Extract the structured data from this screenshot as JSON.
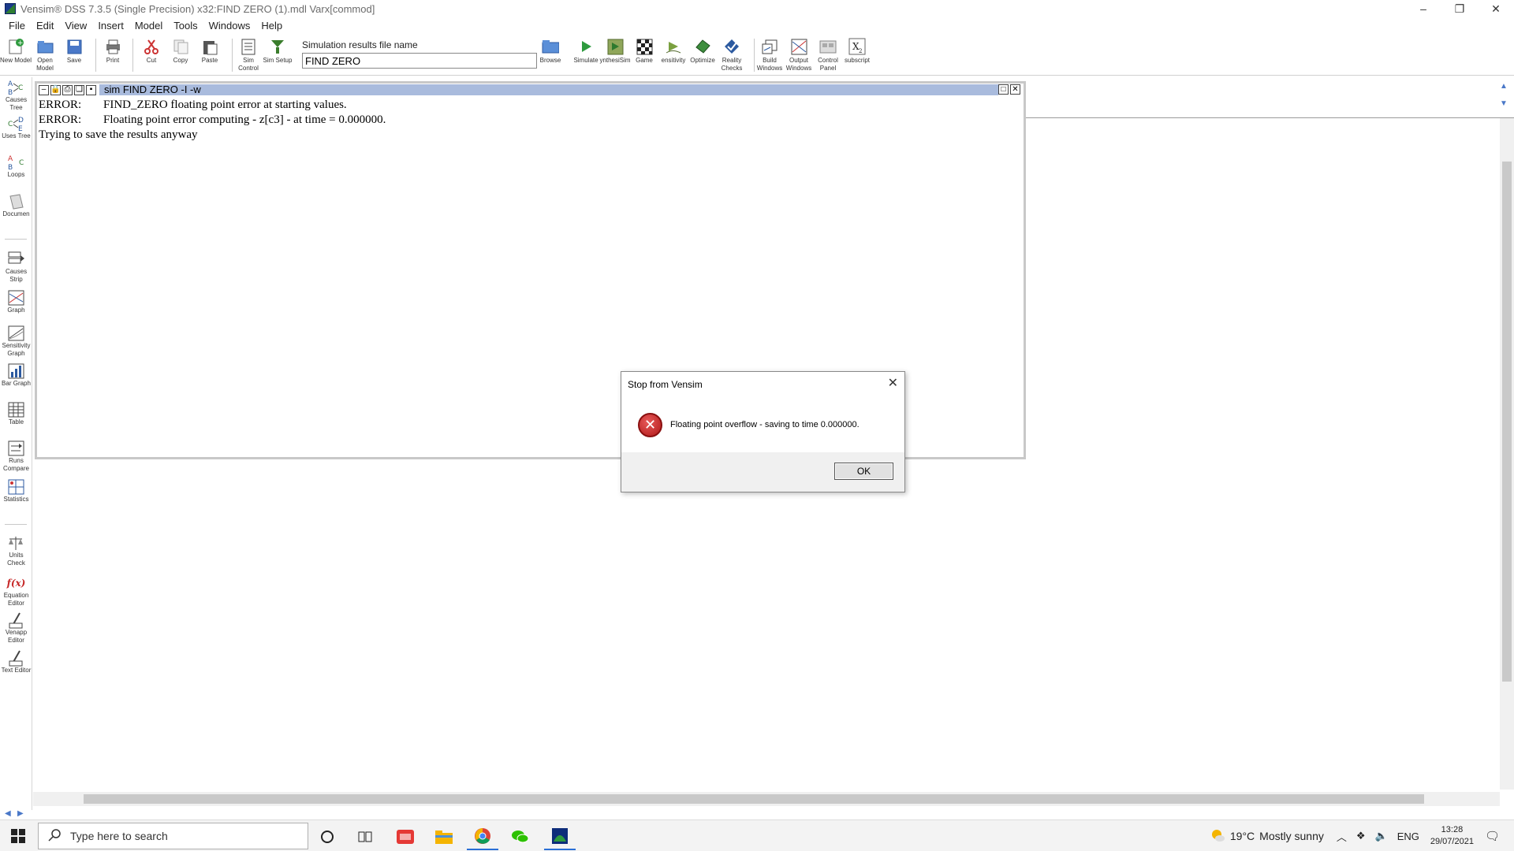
{
  "window": {
    "title": "Vensim® DSS 7.3.5 (Single Precision) x32:FIND ZERO (1).mdl Varx[commod]",
    "controls": [
      "–",
      "❐",
      "✕"
    ]
  },
  "menu": [
    "File",
    "Edit",
    "View",
    "Insert",
    "Model",
    "Tools",
    "Windows",
    "Help"
  ],
  "toolbar": {
    "buttons": [
      {
        "label": "New Model",
        "icon": "new-model-icon"
      },
      {
        "label": "Open Model",
        "icon": "open-model-icon"
      },
      {
        "label": "Save",
        "icon": "save-icon"
      },
      {
        "label": "Print",
        "icon": "print-icon"
      },
      {
        "label": "Cut",
        "icon": "cut-icon"
      },
      {
        "label": "Copy",
        "icon": "copy-icon"
      },
      {
        "label": "Paste",
        "icon": "paste-icon"
      },
      {
        "label": "Sim Control",
        "icon": "sim-control-icon"
      },
      {
        "label": "Sim Setup",
        "icon": "sim-setup-icon"
      },
      {
        "label": "Browse",
        "icon": "browse-icon"
      },
      {
        "label": "Simulate",
        "icon": "simulate-icon"
      },
      {
        "label": "ynthesiSim",
        "icon": "synthesim-icon"
      },
      {
        "label": "Game",
        "icon": "game-icon"
      },
      {
        "label": "ensitivity",
        "icon": "sensitivity-icon"
      },
      {
        "label": "Optimize",
        "icon": "optimize-icon"
      },
      {
        "label": "Reality Checks",
        "icon": "reality-checks-icon"
      },
      {
        "label": "Build Windows",
        "icon": "build-windows-icon"
      },
      {
        "label": "Output Windows",
        "icon": "output-windows-icon"
      },
      {
        "label": "Control Panel",
        "icon": "control-panel-icon"
      },
      {
        "label": "subscript",
        "icon": "subscript-icon"
      }
    ],
    "sim_label": "Simulation results file name",
    "sim_value": "FIND ZERO"
  },
  "sidebar": {
    "tools": [
      {
        "label": "Causes Tree",
        "icon": "causes-tree-icon"
      },
      {
        "label": "Uses Tree",
        "icon": "uses-tree-icon"
      },
      {
        "label": "Loops",
        "icon": "loops-icon"
      },
      {
        "label": "Documen",
        "icon": "document-icon"
      },
      {
        "label": "Causes Strip",
        "icon": "causes-strip-icon"
      },
      {
        "label": "Graph",
        "icon": "graph-icon"
      },
      {
        "label": "Sensitivity Graph",
        "icon": "sensitivity-graph-icon"
      },
      {
        "label": "Bar Graph",
        "icon": "bar-graph-icon"
      },
      {
        "label": "Table",
        "icon": "table-icon"
      },
      {
        "label": "Runs Compare",
        "icon": "runs-compare-icon"
      },
      {
        "label": "Statistics",
        "icon": "statistics-icon"
      },
      {
        "label": "Units Check",
        "icon": "units-check-icon"
      },
      {
        "label": "Equation Editor",
        "icon": "equation-editor-icon"
      },
      {
        "label": "Venapp Editor",
        "icon": "venapp-editor-icon"
      },
      {
        "label": "Text Editor",
        "icon": "text-editor-icon"
      }
    ],
    "fx_glyph": "f(x)"
  },
  "output_window": {
    "caption": "sim  FIND ZERO -I -w",
    "lines": [
      {
        "kind": "ERROR:",
        "text": "FIND_ZERO floating point error at starting values."
      },
      {
        "kind": "ERROR:",
        "text": "Floating point error computing - z[c3] - at time = 0.000000."
      },
      {
        "kind": "",
        "text": "Trying to save the results anyway"
      }
    ]
  },
  "dialog": {
    "title": "Stop from Vensim",
    "message": "Floating point overflow - saving to time 0.000000.",
    "ok_label": "OK",
    "icon": "error-icon"
  },
  "taskbar": {
    "search_placeholder": "Type here to search",
    "weather_temp": "19°C",
    "weather_desc": "Mostly sunny",
    "lang": "ENG",
    "time": "13:28",
    "date": "29/07/2021"
  },
  "colors": {
    "caption_bg": "#a9bbdd",
    "error_red": "#c62828",
    "accent": "#2a6fd6"
  }
}
